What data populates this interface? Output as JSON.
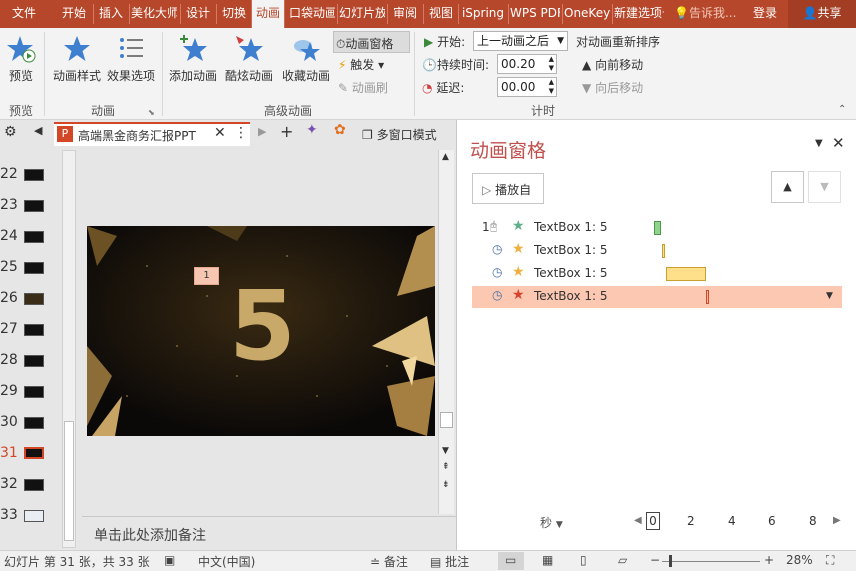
{
  "menu": {
    "tabs": [
      "文件",
      "开始",
      "插入",
      "美化大师",
      "设计",
      "切换",
      "动画",
      "口袋动画",
      "幻灯片放映",
      "审阅",
      "视图",
      "iSpring",
      "WPS PDF",
      "OneKey",
      "新建选项卡"
    ],
    "search": "告诉我...",
    "login": "登录",
    "share": "共享"
  },
  "ribbon": {
    "preview": "预览",
    "anim_style": "动画样式",
    "effect_options": "效果选项",
    "add_anim": "添加动画",
    "cool_anim": "酷炫动画",
    "fav_anim": "收藏动画",
    "anim_pane": "动画窗格",
    "trigger": "触发",
    "anim_brush": "动画刷",
    "start_label": "开始:",
    "start_value": "上一动画之后",
    "duration_label": "持续时间:",
    "duration_value": "00.20",
    "delay_label": "延迟:",
    "delay_value": "00.00",
    "reorder": "对动画重新排序",
    "move_forward": "向前移动",
    "move_back": "向后移动",
    "groups": {
      "preview": "预览",
      "animation": "动画",
      "advanced": "高级动画",
      "timing": "计时"
    }
  },
  "slides": {
    "numbers": [
      "22",
      "23",
      "24",
      "25",
      "26",
      "27",
      "28",
      "29",
      "30",
      "31",
      "32",
      "33"
    ],
    "selected": "31"
  },
  "doc": {
    "tab_title": "高端黑金商务汇报PPT",
    "multi_window": "多窗口模式",
    "slide_number": "5",
    "anim_tag": "1",
    "notes": "单击此处添加备注"
  },
  "pane": {
    "title": "动画窗格",
    "play": "播放自",
    "items": [
      {
        "order": "1",
        "name": "TextBox 1: 5"
      },
      {
        "order": "",
        "name": "TextBox 1: 5"
      },
      {
        "order": "",
        "name": "TextBox 1: 5"
      },
      {
        "order": "",
        "name": "TextBox 1: 5"
      }
    ],
    "seconds": "秒",
    "timeline": [
      "0",
      "2",
      "4",
      "6",
      "8"
    ]
  },
  "status": {
    "slide": "幻灯片 第 31 张，共 33 张",
    "lang": "中文(中国)",
    "notes": "备注",
    "comments": "批注",
    "zoom": "28%"
  },
  "colors": {
    "accent": "#b7472a",
    "selected_row": "#fcc8b2",
    "gold": "#c9a96a"
  }
}
